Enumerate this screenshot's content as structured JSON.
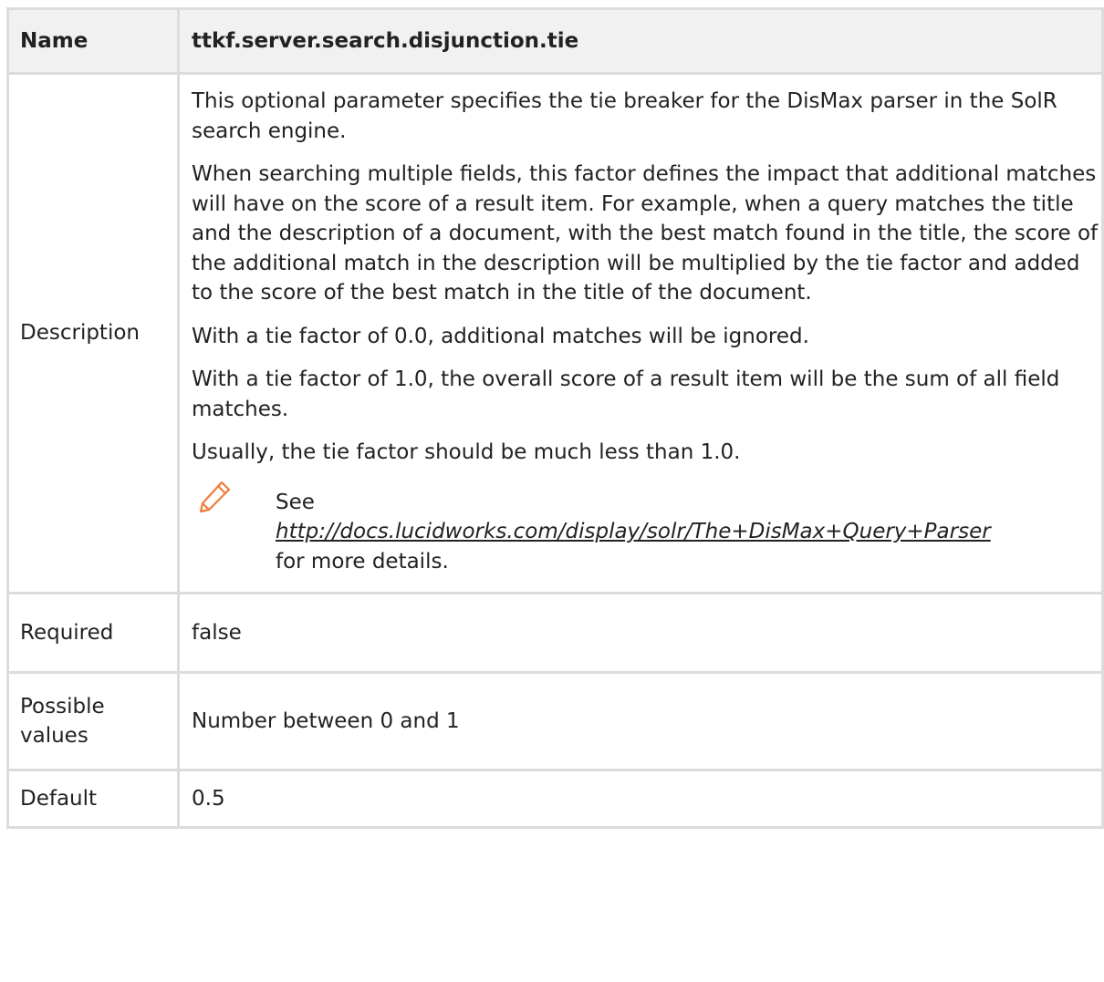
{
  "header": {
    "name_label": "Name",
    "name_value": "ttkf.server.search.disjunction.tie"
  },
  "description": {
    "label": "Description",
    "paragraphs": [
      "This optional parameter specifies the tie breaker for the DisMax parser in the SolR search engine.",
      "When searching multiple fields, this factor defines the impact that additional matches will have on the score of a result item. For example, when a query matches the title and the description of a document, with the best match found in the title, the score of the additional match in the description will be multiplied by the tie factor and added to the score of the best match in the title of the document.",
      "With a tie factor of 0.0, additional matches will be ignored.",
      "With a tie factor of 1.0, the overall score of a result item will be the sum of all field matches.",
      "Usually, the tie factor should be much less than 1.0."
    ],
    "note": {
      "icon": "pencil-icon",
      "prefix": "See",
      "link_text": "http://docs.lucidworks.com/display/solr/The+DisMax+Query+Parser",
      "suffix": "for more details."
    }
  },
  "required": {
    "label": "Required",
    "value": "false"
  },
  "possible_values": {
    "label": "Possible values",
    "value": "Number between 0 and 1"
  },
  "default": {
    "label": "Default",
    "value": "0.5"
  },
  "colors": {
    "icon": "#f07c3a",
    "border": "#dcdcdc",
    "header_bg": "#f1f1f1"
  }
}
